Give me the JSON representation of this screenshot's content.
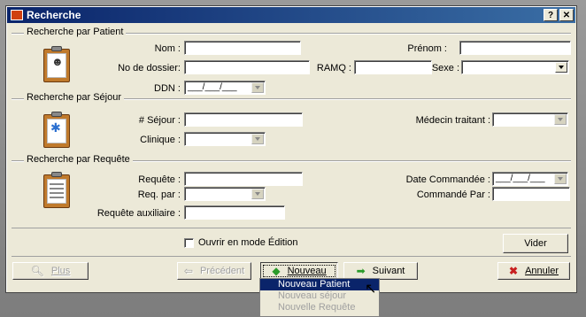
{
  "window": {
    "title": "Recherche",
    "help_btn": "?",
    "close_btn": "✕"
  },
  "patient": {
    "group_label": "Recherche par Patient",
    "nom_label": "Nom :",
    "nom_value": "",
    "prenom_label": "Prénom :",
    "prenom_value": "",
    "dossier_label": "No de dossier:",
    "dossier_value": "",
    "ramq_label": "RAMQ :",
    "ramq_value": "",
    "sexe_label": "Sexe :",
    "sexe_value": "",
    "ddn_label": "DDN :",
    "ddn_value": "___/___/___"
  },
  "sejour": {
    "group_label": "Recherche par Séjour",
    "num_label": "# Séjour :",
    "num_value": "",
    "medecin_label": "Médecin traitant :",
    "medecin_value": "",
    "clinique_label": "Clinique :",
    "clinique_value": ""
  },
  "requete": {
    "group_label": "Recherche par Requête",
    "requete_label": "Requête :",
    "requete_value": "",
    "date_label": "Date Commandée :",
    "date_value": "___/___/___",
    "reqpar_label": "Req. par :",
    "reqpar_value": "",
    "commande_label": "Commandé Par :",
    "commande_value": "",
    "aux_label": "Requête auxiliaire :",
    "aux_value": ""
  },
  "edit_mode": {
    "label": "Ouvrir en mode Édition",
    "checked": false
  },
  "buttons": {
    "vider": "Vider",
    "plus": "Plus",
    "precedent": "Précédent",
    "nouveau": "Nouveau",
    "suivant": "Suivant",
    "annuler": "Annuler"
  },
  "menu": {
    "items": [
      "Nouveau Patient",
      "Nouveau séjour",
      "Nouvelle Requête"
    ]
  },
  "colors": {
    "title_bar": "#0a246a",
    "dialog_bg": "#ece9d8",
    "menu_highlight": "#0a246a"
  },
  "icons": {
    "title": "folder-icon",
    "patient": "patient-clipboard-icon",
    "sejour": "medical-clipboard-icon",
    "requete": "document-clipboard-icon",
    "plus": "magnifier-icon",
    "precedent": "arrow-left-icon",
    "nouveau": "green-diamond-icon",
    "suivant": "arrow-right-icon",
    "annuler": "red-x-icon"
  }
}
